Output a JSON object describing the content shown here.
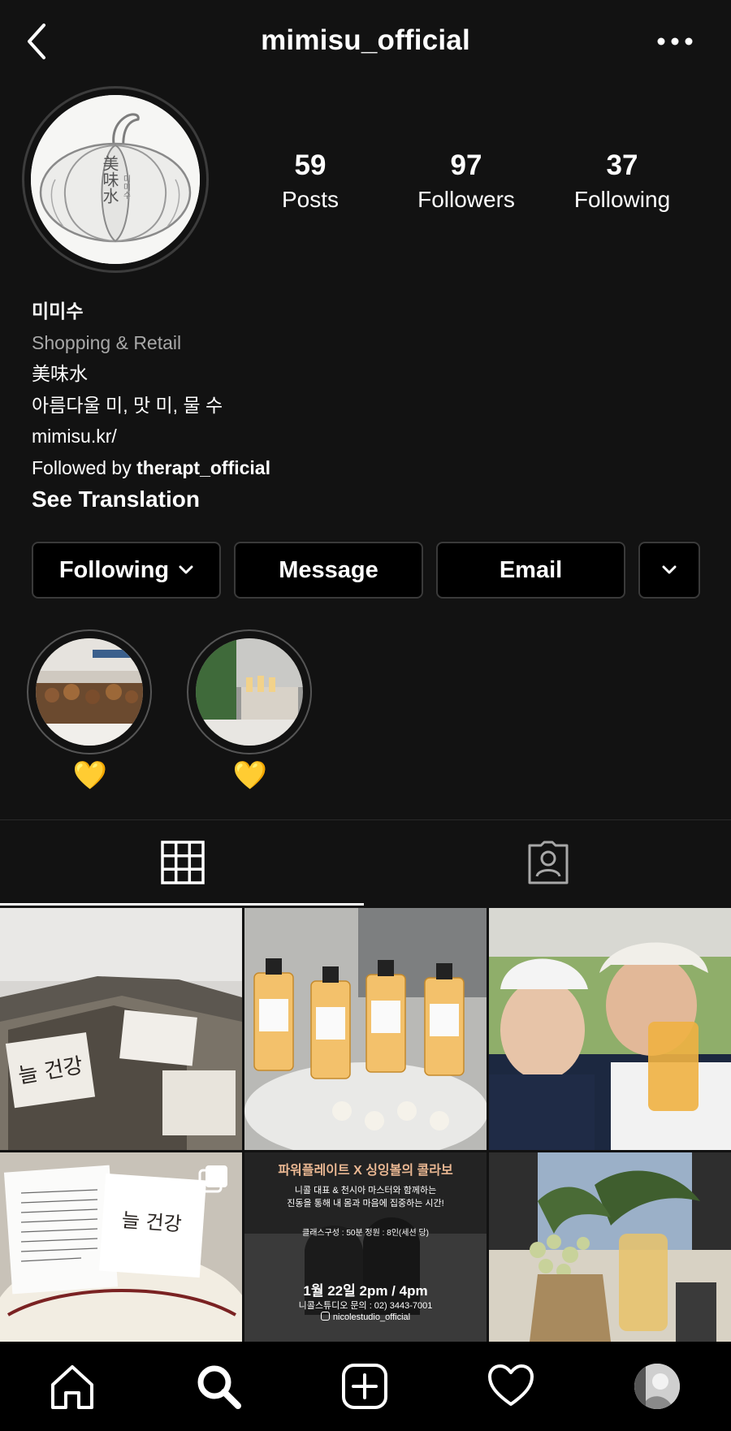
{
  "header": {
    "username": "mimisu_official"
  },
  "profile": {
    "avatar_text": "美味水",
    "avatar_small_text": "미미수",
    "stats": [
      {
        "value": "59",
        "label": "Posts"
      },
      {
        "value": "97",
        "label": "Followers"
      },
      {
        "value": "37",
        "label": "Following"
      }
    ],
    "name": "미미수",
    "category": "Shopping & Retail",
    "bio_line1": "美味水",
    "bio_line2": "아름다울 미, 맛 미, 물 수",
    "website": "mimisu.kr/",
    "followed_by_prefix": "Followed by ",
    "followed_by_user": "therapt_official",
    "see_translation": "See Translation"
  },
  "actions": {
    "following": "Following",
    "message": "Message",
    "email": "Email"
  },
  "highlights": [
    {
      "label": "💛"
    },
    {
      "label": "💛"
    }
  ],
  "posts": {
    "item1_text": "늘 건강",
    "item4_text": "늘 건강",
    "promo_title": "파워플레이트 X 싱잉볼의 콜라보",
    "promo_sub1": "니콜 대표 & 천시아 마스터와 함께하는",
    "promo_sub2": "진동을 통해 내 몸과 마음에 집중하는 시간!",
    "promo_info": "클래스구성 : 50분   정원 : 8인(세션 당)",
    "promo_date": "1월 22일 2pm / 4pm",
    "promo_contact": "니콜스튜디오 문의 : 02) 3443-7001",
    "promo_handle": "nicolestudio_official"
  },
  "colors": {
    "background": "#121212",
    "button_border": "#3a3a3a",
    "secondary_text": "#a8a8a8",
    "promo_accent": "#e9b792"
  }
}
